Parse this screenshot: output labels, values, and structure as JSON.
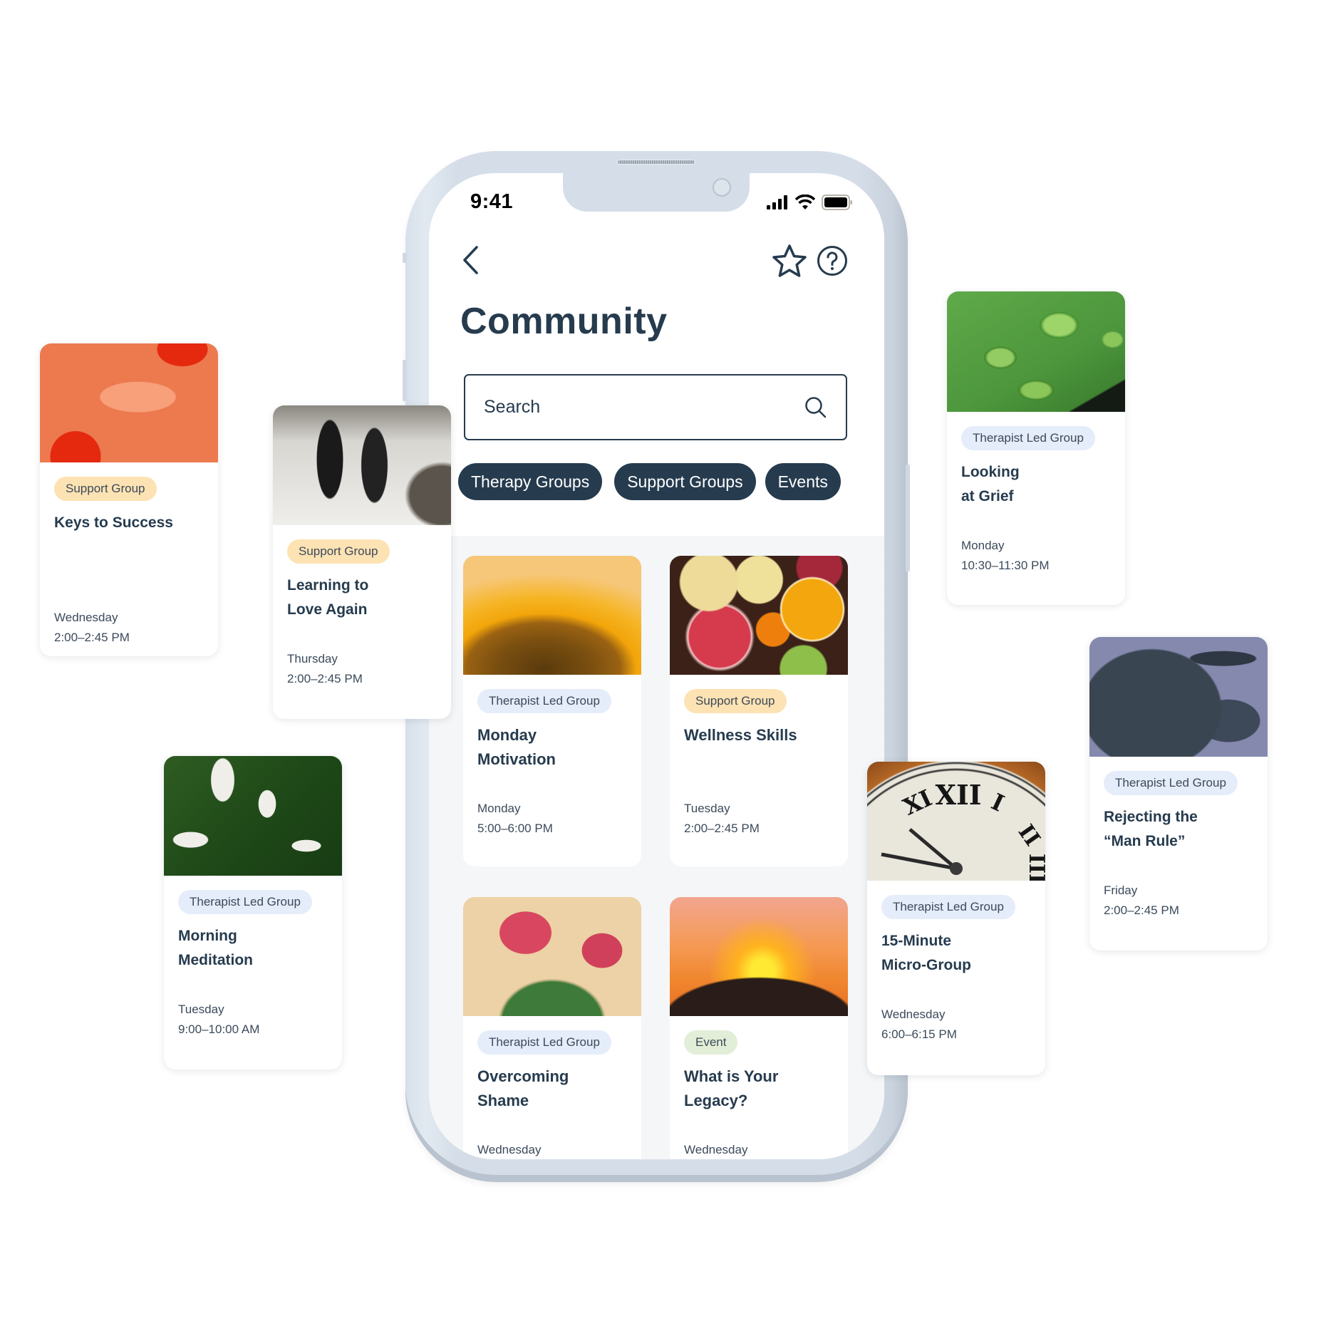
{
  "status_bar": {
    "time": "9:41"
  },
  "header": {
    "back_icon": "chevron-left-icon",
    "favorite_icon": "star-icon",
    "help_icon": "question-circle-icon"
  },
  "page": {
    "title": "Community"
  },
  "search": {
    "placeholder": "Search",
    "icon": "search-icon"
  },
  "filters": [
    {
      "label": "Therapy Groups"
    },
    {
      "label": "Support Groups"
    },
    {
      "label": "Events"
    }
  ],
  "feed_cards": [
    {
      "tag": "Therapist Led Group",
      "tag_type": "therapist",
      "title": "Monday Motivation",
      "day": "Monday",
      "time": "5:00–6:00 PM",
      "image": "sunflower"
    },
    {
      "tag": "Support Group",
      "tag_type": "support",
      "title": "Wellness Skills",
      "day": "Tuesday",
      "time": "2:00–2:45 PM",
      "image": "citrus"
    },
    {
      "tag": "Therapist Led Group",
      "tag_type": "therapist",
      "title": "Overcoming Shame",
      "day": "Wednesday",
      "time": "",
      "image": "cactus"
    },
    {
      "tag": "Event",
      "tag_type": "event",
      "title": "What is Your Legacy?",
      "day": "Wednesday",
      "time": "",
      "image": "sunset"
    }
  ],
  "floating_cards": [
    {
      "tag": "Support Group",
      "tag_type": "support",
      "title": "Keys to Success",
      "day": "Wednesday",
      "time": "2:00–2:45 PM",
      "image": "hands"
    },
    {
      "tag": "Support Group",
      "tag_type": "support",
      "title": "Learning to Love Again",
      "day": "Thursday",
      "time": "2:00–2:45 PM",
      "image": "reflection"
    },
    {
      "tag": "Therapist Led Group",
      "tag_type": "therapist",
      "title": "Morning Meditation",
      "day": "Tuesday",
      "time": "9:00–10:00 AM",
      "image": "monstera"
    },
    {
      "tag": "Therapist Led Group",
      "tag_type": "therapist",
      "title": "Looking at Grief",
      "day": "Monday",
      "time": "10:30–11:30 PM",
      "image": "leaf-drops"
    },
    {
      "tag": "Therapist Led Group",
      "tag_type": "therapist",
      "title": "Rejecting the “Man Rule”",
      "day": "Friday",
      "time": "2:00–2:45 PM",
      "image": "bull"
    },
    {
      "tag": "Therapist Led Group",
      "tag_type": "therapist",
      "title": "15-Minute Micro-Group",
      "day": "Wednesday",
      "time": "6:00–6:15 PM",
      "image": "clock"
    }
  ],
  "colors": {
    "primary": "#263b4e",
    "tag_therapist": "#e5ecfa",
    "tag_support": "#fde2b3",
    "tag_event": "#e3eed8",
    "feed_background": "#f4f6f8"
  }
}
